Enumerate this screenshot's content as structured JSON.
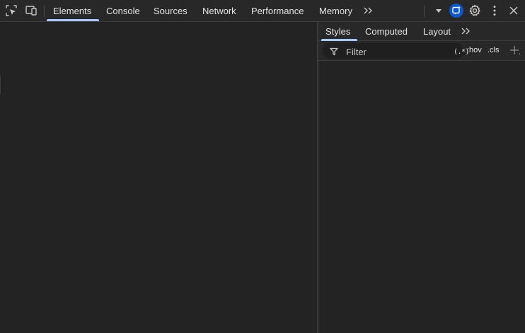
{
  "toolbar": {
    "tabs": [
      {
        "label": "Elements",
        "active": true
      },
      {
        "label": "Console",
        "active": false
      },
      {
        "label": "Sources",
        "active": false
      },
      {
        "label": "Network",
        "active": false
      },
      {
        "label": "Performance",
        "active": false
      },
      {
        "label": "Memory",
        "active": false
      }
    ],
    "icons": {
      "inspect": "inspect-element-icon",
      "device": "device-toolbar-icon",
      "overflow": "chevron-double-right-icon",
      "dropdown": "caret-down-icon",
      "ai": "ai-assistant-icon",
      "settings": "gear-icon",
      "more": "kebab-menu-icon",
      "close": "close-icon"
    }
  },
  "sidebar": {
    "tabs": [
      {
        "label": "Styles",
        "active": true
      },
      {
        "label": "Computed",
        "active": false
      },
      {
        "label": "Layout",
        "active": false
      }
    ],
    "filter": {
      "placeholder": "Filter",
      "regex_label": "(.*)",
      "hov_label": ":hov",
      "cls_label": ".cls"
    }
  },
  "colors": {
    "background": "#232323",
    "toolbar": "#282828",
    "accent": "#a8c7fa",
    "ai_badge": "#0b57d0",
    "text": "#e3e3e3"
  }
}
